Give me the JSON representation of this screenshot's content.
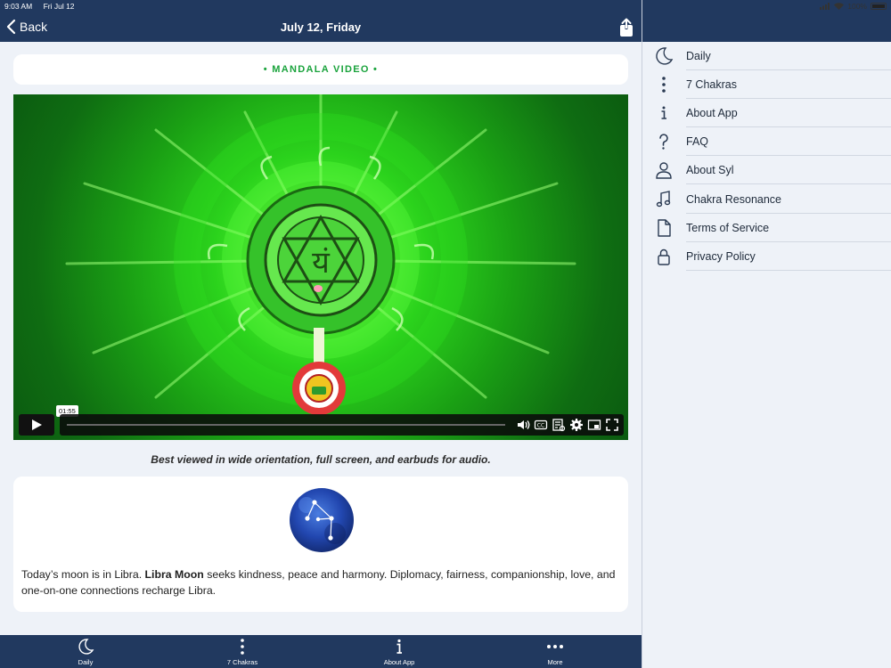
{
  "status_bar": {
    "time": "9:03 AM",
    "date": "Fri Jul 12",
    "battery": "100%"
  },
  "nav": {
    "back_label": "Back",
    "title": "July 12, Friday"
  },
  "section": {
    "label": "• MANDALA VIDEO •"
  },
  "video": {
    "time_tooltip": "01:55",
    "controls": [
      "play-icon",
      "volume-icon",
      "cc-icon",
      "transcript-icon",
      "settings-icon",
      "pip-icon",
      "fullscreen-icon"
    ],
    "glyph": "यं"
  },
  "caption": "Best viewed in wide orientation, full screen, and earbuds for audio.",
  "moon": {
    "text_before": "Today’s moon is in Libra. ",
    "bold": "Libra Moon",
    "text_after": " seeks kindness, peace and harmony. Diplomacy, fairness, companionship, love, and one-on-one connections recharge Libra."
  },
  "tabs": [
    {
      "label": "Daily",
      "icon": "moon-icon"
    },
    {
      "label": "7 Chakras",
      "icon": "dots-vertical-icon"
    },
    {
      "label": "About App",
      "icon": "info-icon"
    },
    {
      "label": "More",
      "icon": "more-icon"
    }
  ],
  "menu": [
    {
      "label": "Daily",
      "icon": "moon-icon"
    },
    {
      "label": "7 Chakras",
      "icon": "dots-vertical-icon"
    },
    {
      "label": "About App",
      "icon": "info-icon"
    },
    {
      "label": "FAQ",
      "icon": "question-icon"
    },
    {
      "label": "About Syl",
      "icon": "person-icon"
    },
    {
      "label": "Chakra Resonance",
      "icon": "music-note-icon"
    },
    {
      "label": "Terms of Service",
      "icon": "document-icon"
    },
    {
      "label": "Privacy Policy",
      "icon": "lock-icon"
    }
  ],
  "colors": {
    "nav_bg": "#21395f",
    "accent_green": "#1aa33c",
    "page_bg": "#eef2f8"
  }
}
